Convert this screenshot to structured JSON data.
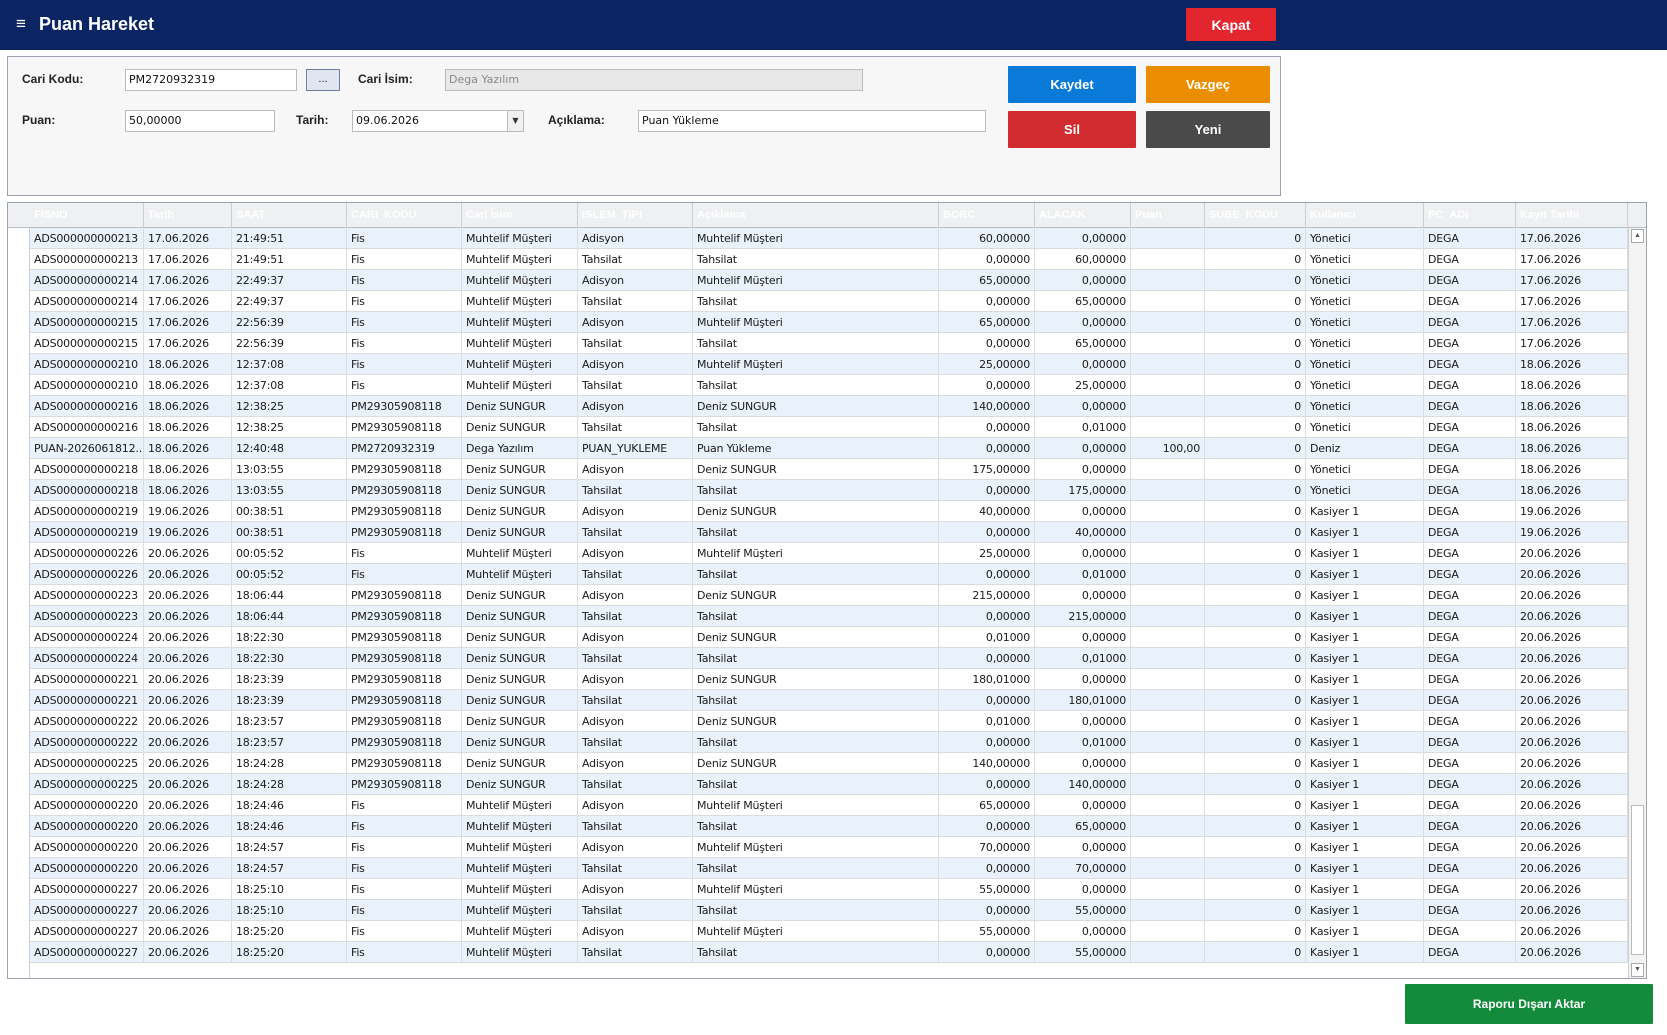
{
  "window": {
    "title": "Puan Hareket",
    "close_label": "Kapat"
  },
  "form": {
    "cari_kodu_label": "Cari Kodu:",
    "cari_kodu_value": "PM2720932319",
    "lookup_label": "...",
    "cari_isim_label": "Cari İsim:",
    "cari_isim_value": "Dega Yazılım",
    "puan_label": "Puan:",
    "puan_value": "50,00000",
    "tarih_label": "Tarih:",
    "tarih_value": "09.06.2026",
    "aciklama_label": "Açıklama:",
    "aciklama_value": "Puan Yükleme"
  },
  "actions": {
    "save": "Kaydet",
    "cancel": "Vazgeç",
    "delete": "Sil",
    "new": "Yeni",
    "export": "Raporu Dışarı Aktar"
  },
  "grid": {
    "columns": [
      "FISNO",
      "Tarih",
      "SAAT",
      "CARI_KODU",
      "Cari İsim",
      "ISLEM_TIPI",
      "Açıklama",
      "BORC",
      "ALACAK",
      "Puan",
      "SUBE_KODU",
      "Kullanıcı",
      "PC_ADI",
      "Kayıt Tarihi"
    ],
    "rows": [
      [
        "ADS000000000213",
        "17.06.2026",
        "21:49:51",
        "Fis",
        "Muhtelif Müşteri",
        "Adisyon",
        "Muhtelif Müşteri",
        "60,00000",
        "0,00000",
        "",
        "0",
        "Yönetici",
        "DEGA",
        "17.06.2026"
      ],
      [
        "ADS000000000213",
        "17.06.2026",
        "21:49:51",
        "Fis",
        "Muhtelif Müşteri",
        "Tahsilat",
        "Tahsilat",
        "0,00000",
        "60,00000",
        "",
        "0",
        "Yönetici",
        "DEGA",
        "17.06.2026"
      ],
      [
        "ADS000000000214",
        "17.06.2026",
        "22:49:37",
        "Fis",
        "Muhtelif Müşteri",
        "Adisyon",
        "Muhtelif Müşteri",
        "65,00000",
        "0,00000",
        "",
        "0",
        "Yönetici",
        "DEGA",
        "17.06.2026"
      ],
      [
        "ADS000000000214",
        "17.06.2026",
        "22:49:37",
        "Fis",
        "Muhtelif Müşteri",
        "Tahsilat",
        "Tahsilat",
        "0,00000",
        "65,00000",
        "",
        "0",
        "Yönetici",
        "DEGA",
        "17.06.2026"
      ],
      [
        "ADS000000000215",
        "17.06.2026",
        "22:56:39",
        "Fis",
        "Muhtelif Müşteri",
        "Adisyon",
        "Muhtelif Müşteri",
        "65,00000",
        "0,00000",
        "",
        "0",
        "Yönetici",
        "DEGA",
        "17.06.2026"
      ],
      [
        "ADS000000000215",
        "17.06.2026",
        "22:56:39",
        "Fis",
        "Muhtelif Müşteri",
        "Tahsilat",
        "Tahsilat",
        "0,00000",
        "65,00000",
        "",
        "0",
        "Yönetici",
        "DEGA",
        "17.06.2026"
      ],
      [
        "ADS000000000210",
        "18.06.2026",
        "12:37:08",
        "Fis",
        "Muhtelif Müşteri",
        "Adisyon",
        "Muhtelif Müşteri",
        "25,00000",
        "0,00000",
        "",
        "0",
        "Yönetici",
        "DEGA",
        "18.06.2026"
      ],
      [
        "ADS000000000210",
        "18.06.2026",
        "12:37:08",
        "Fis",
        "Muhtelif Müşteri",
        "Tahsilat",
        "Tahsilat",
        "0,00000",
        "25,00000",
        "",
        "0",
        "Yönetici",
        "DEGA",
        "18.06.2026"
      ],
      [
        "ADS000000000216",
        "18.06.2026",
        "12:38:25",
        "PM29305908118",
        "Deniz SUNGUR",
        "Adisyon",
        "Deniz SUNGUR",
        "140,00000",
        "0,00000",
        "",
        "0",
        "Yönetici",
        "DEGA",
        "18.06.2026"
      ],
      [
        "ADS000000000216",
        "18.06.2026",
        "12:38:25",
        "PM29305908118",
        "Deniz SUNGUR",
        "Tahsilat",
        "Tahsilat",
        "0,00000",
        "0,01000",
        "",
        "0",
        "Yönetici",
        "DEGA",
        "18.06.2026"
      ],
      [
        "PUAN-2026061812...",
        "18.06.2026",
        "12:40:48",
        "PM2720932319",
        "Dega Yazılım",
        "PUAN_YUKLEME",
        "Puan Yükleme",
        "0,00000",
        "0,00000",
        "100,00",
        "0",
        "Deniz",
        "DEGA",
        "18.06.2026"
      ],
      [
        "ADS000000000218",
        "18.06.2026",
        "13:03:55",
        "PM29305908118",
        "Deniz SUNGUR",
        "Adisyon",
        "Deniz SUNGUR",
        "175,00000",
        "0,00000",
        "",
        "0",
        "Yönetici",
        "DEGA",
        "18.06.2026"
      ],
      [
        "ADS000000000218",
        "18.06.2026",
        "13:03:55",
        "PM29305908118",
        "Deniz SUNGUR",
        "Tahsilat",
        "Tahsilat",
        "0,00000",
        "175,00000",
        "",
        "0",
        "Yönetici",
        "DEGA",
        "18.06.2026"
      ],
      [
        "ADS000000000219",
        "19.06.2026",
        "00:38:51",
        "PM29305908118",
        "Deniz SUNGUR",
        "Adisyon",
        "Deniz SUNGUR",
        "40,00000",
        "0,00000",
        "",
        "0",
        "Kasiyer 1",
        "DEGA",
        "19.06.2026"
      ],
      [
        "ADS000000000219",
        "19.06.2026",
        "00:38:51",
        "PM29305908118",
        "Deniz SUNGUR",
        "Tahsilat",
        "Tahsilat",
        "0,00000",
        "40,00000",
        "",
        "0",
        "Kasiyer 1",
        "DEGA",
        "19.06.2026"
      ],
      [
        "ADS000000000226",
        "20.06.2026",
        "00:05:52",
        "Fis",
        "Muhtelif Müşteri",
        "Adisyon",
        "Muhtelif Müşteri",
        "25,00000",
        "0,00000",
        "",
        "0",
        "Kasiyer 1",
        "DEGA",
        "20.06.2026"
      ],
      [
        "ADS000000000226",
        "20.06.2026",
        "00:05:52",
        "Fis",
        "Muhtelif Müşteri",
        "Tahsilat",
        "Tahsilat",
        "0,00000",
        "0,01000",
        "",
        "0",
        "Kasiyer 1",
        "DEGA",
        "20.06.2026"
      ],
      [
        "ADS000000000223",
        "20.06.2026",
        "18:06:44",
        "PM29305908118",
        "Deniz SUNGUR",
        "Adisyon",
        "Deniz SUNGUR",
        "215,00000",
        "0,00000",
        "",
        "0",
        "Kasiyer 1",
        "DEGA",
        "20.06.2026"
      ],
      [
        "ADS000000000223",
        "20.06.2026",
        "18:06:44",
        "PM29305908118",
        "Deniz SUNGUR",
        "Tahsilat",
        "Tahsilat",
        "0,00000",
        "215,00000",
        "",
        "0",
        "Kasiyer 1",
        "DEGA",
        "20.06.2026"
      ],
      [
        "ADS000000000224",
        "20.06.2026",
        "18:22:30",
        "PM29305908118",
        "Deniz SUNGUR",
        "Adisyon",
        "Deniz SUNGUR",
        "0,01000",
        "0,00000",
        "",
        "0",
        "Kasiyer 1",
        "DEGA",
        "20.06.2026"
      ],
      [
        "ADS000000000224",
        "20.06.2026",
        "18:22:30",
        "PM29305908118",
        "Deniz SUNGUR",
        "Tahsilat",
        "Tahsilat",
        "0,00000",
        "0,01000",
        "",
        "0",
        "Kasiyer 1",
        "DEGA",
        "20.06.2026"
      ],
      [
        "ADS000000000221",
        "20.06.2026",
        "18:23:39",
        "PM29305908118",
        "Deniz SUNGUR",
        "Adisyon",
        "Deniz SUNGUR",
        "180,01000",
        "0,00000",
        "",
        "0",
        "Kasiyer 1",
        "DEGA",
        "20.06.2026"
      ],
      [
        "ADS000000000221",
        "20.06.2026",
        "18:23:39",
        "PM29305908118",
        "Deniz SUNGUR",
        "Tahsilat",
        "Tahsilat",
        "0,00000",
        "180,01000",
        "",
        "0",
        "Kasiyer 1",
        "DEGA",
        "20.06.2026"
      ],
      [
        "ADS000000000222",
        "20.06.2026",
        "18:23:57",
        "PM29305908118",
        "Deniz SUNGUR",
        "Adisyon",
        "Deniz SUNGUR",
        "0,01000",
        "0,00000",
        "",
        "0",
        "Kasiyer 1",
        "DEGA",
        "20.06.2026"
      ],
      [
        "ADS000000000222",
        "20.06.2026",
        "18:23:57",
        "PM29305908118",
        "Deniz SUNGUR",
        "Tahsilat",
        "Tahsilat",
        "0,00000",
        "0,01000",
        "",
        "0",
        "Kasiyer 1",
        "DEGA",
        "20.06.2026"
      ],
      [
        "ADS000000000225",
        "20.06.2026",
        "18:24:28",
        "PM29305908118",
        "Deniz SUNGUR",
        "Adisyon",
        "Deniz SUNGUR",
        "140,00000",
        "0,00000",
        "",
        "0",
        "Kasiyer 1",
        "DEGA",
        "20.06.2026"
      ],
      [
        "ADS000000000225",
        "20.06.2026",
        "18:24:28",
        "PM29305908118",
        "Deniz SUNGUR",
        "Tahsilat",
        "Tahsilat",
        "0,00000",
        "140,00000",
        "",
        "0",
        "Kasiyer 1",
        "DEGA",
        "20.06.2026"
      ],
      [
        "ADS000000000220",
        "20.06.2026",
        "18:24:46",
        "Fis",
        "Muhtelif Müşteri",
        "Adisyon",
        "Muhtelif Müşteri",
        "65,00000",
        "0,00000",
        "",
        "0",
        "Kasiyer 1",
        "DEGA",
        "20.06.2026"
      ],
      [
        "ADS000000000220",
        "20.06.2026",
        "18:24:46",
        "Fis",
        "Muhtelif Müşteri",
        "Tahsilat",
        "Tahsilat",
        "0,00000",
        "65,00000",
        "",
        "0",
        "Kasiyer 1",
        "DEGA",
        "20.06.2026"
      ],
      [
        "ADS000000000220",
        "20.06.2026",
        "18:24:57",
        "Fis",
        "Muhtelif Müşteri",
        "Adisyon",
        "Muhtelif Müşteri",
        "70,00000",
        "0,00000",
        "",
        "0",
        "Kasiyer 1",
        "DEGA",
        "20.06.2026"
      ],
      [
        "ADS000000000220",
        "20.06.2026",
        "18:24:57",
        "Fis",
        "Muhtelif Müşteri",
        "Tahsilat",
        "Tahsilat",
        "0,00000",
        "70,00000",
        "",
        "0",
        "Kasiyer 1",
        "DEGA",
        "20.06.2026"
      ],
      [
        "ADS000000000227",
        "20.06.2026",
        "18:25:10",
        "Fis",
        "Muhtelif Müşteri",
        "Adisyon",
        "Muhtelif Müşteri",
        "55,00000",
        "0,00000",
        "",
        "0",
        "Kasiyer 1",
        "DEGA",
        "20.06.2026"
      ],
      [
        "ADS000000000227",
        "20.06.2026",
        "18:25:10",
        "Fis",
        "Muhtelif Müşteri",
        "Tahsilat",
        "Tahsilat",
        "0,00000",
        "55,00000",
        "",
        "0",
        "Kasiyer 1",
        "DEGA",
        "20.06.2026"
      ],
      [
        "ADS000000000227",
        "20.06.2026",
        "18:25:20",
        "Fis",
        "Muhtelif Müşteri",
        "Adisyon",
        "Muhtelif Müşteri",
        "55,00000",
        "0,00000",
        "",
        "0",
        "Kasiyer 1",
        "DEGA",
        "20.06.2026"
      ],
      [
        "ADS000000000227",
        "20.06.2026",
        "18:25:20",
        "Fis",
        "Muhtelif Müşteri",
        "Tahsilat",
        "Tahsilat",
        "0,00000",
        "55,00000",
        "",
        "0",
        "Kasiyer 1",
        "DEGA",
        "20.06.2026"
      ]
    ]
  },
  "colors": {
    "title_bar": "#0b2563",
    "close": "#e3262d",
    "save": "#0a7ad8",
    "cancel": "#ea8d00",
    "delete": "#d12b30",
    "new": "#4a4a4a",
    "export": "#138b3b",
    "row_alt": "#e9f1fb"
  }
}
